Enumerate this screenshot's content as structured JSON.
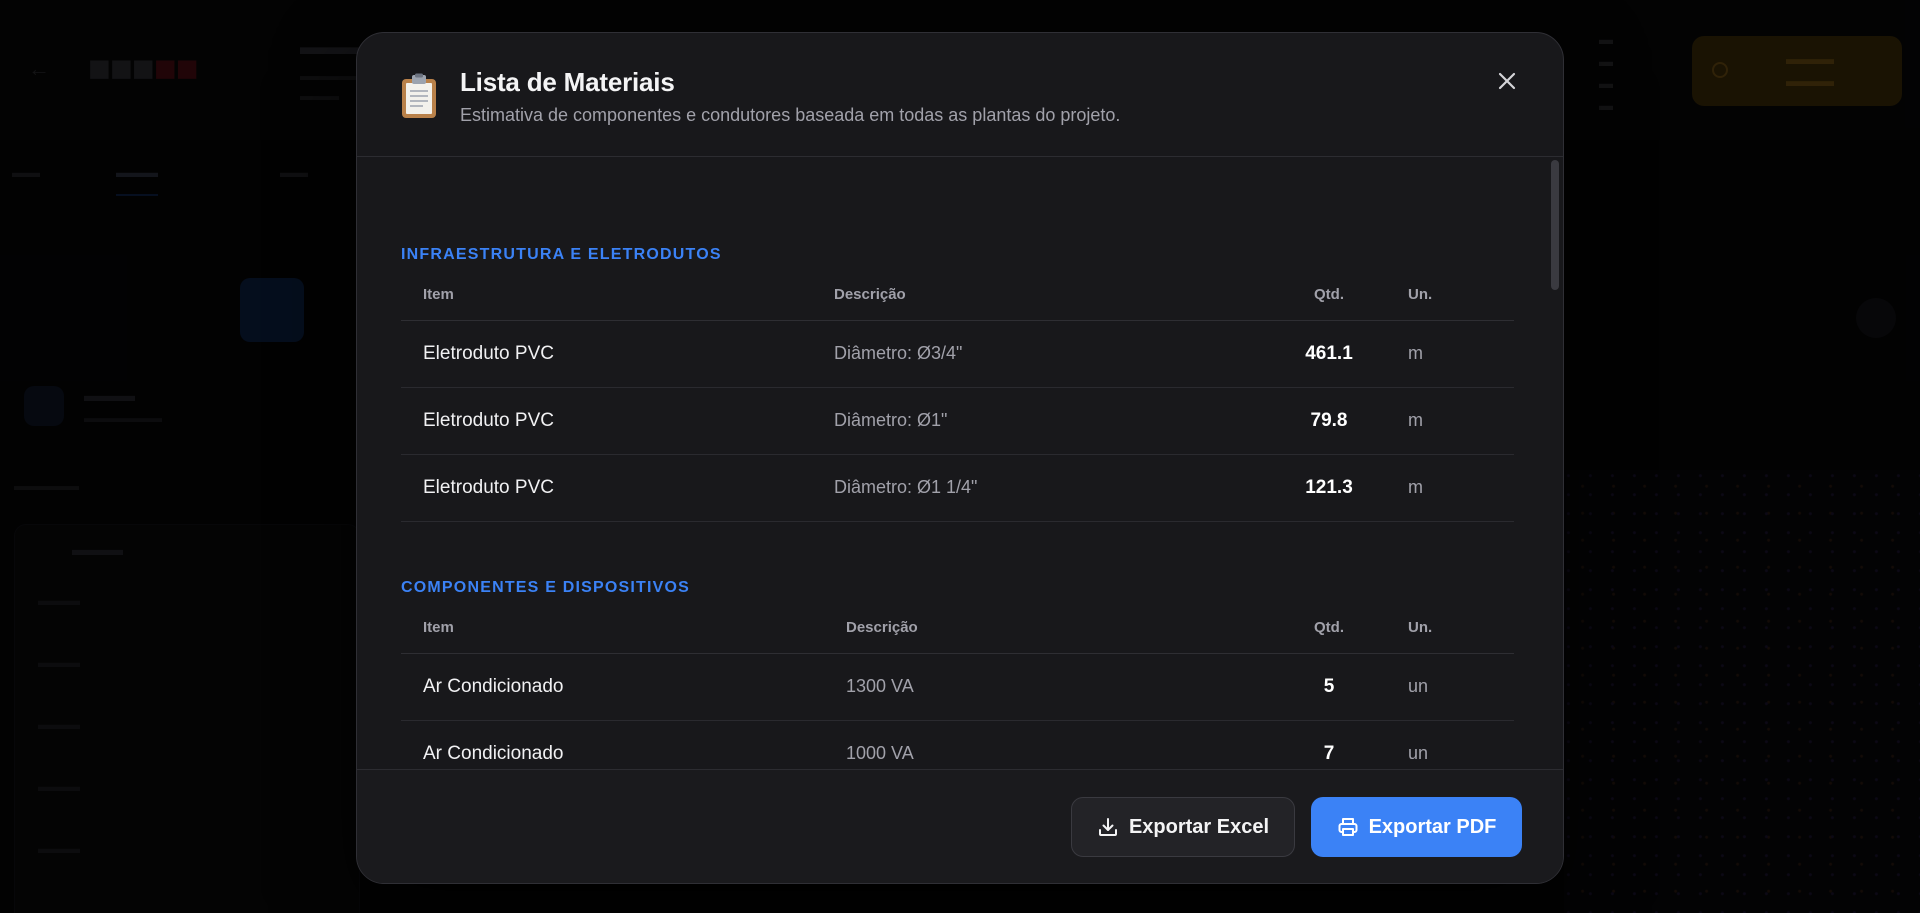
{
  "modal": {
    "title": "Lista de Materiais",
    "subtitle": "Estimativa de componentes e condutores baseada em todas as plantas do projeto.",
    "header_icon": "clipboard-icon",
    "close_icon": "close-icon"
  },
  "sections": [
    {
      "title": "INFRAESTRUTURA E ELETRODUTOS",
      "columns": {
        "item": "Item",
        "description": "Descrição",
        "qty": "Qtd.",
        "unit": "Un."
      },
      "rows": [
        {
          "item": "Eletroduto PVC",
          "description": "Diâmetro: Ø3/4\"",
          "qty": "461.1",
          "unit": "m"
        },
        {
          "item": "Eletroduto PVC",
          "description": "Diâmetro: Ø1\"",
          "qty": "79.8",
          "unit": "m"
        },
        {
          "item": "Eletroduto PVC",
          "description": "Diâmetro: Ø1 1/4\"",
          "qty": "121.3",
          "unit": "m"
        }
      ]
    },
    {
      "title": "COMPONENTES E DISPOSITIVOS",
      "columns": {
        "item": "Item",
        "description": "Descrição",
        "qty": "Qtd.",
        "unit": "Un."
      },
      "rows": [
        {
          "item": "Ar Condicionado",
          "description": "1300 VA",
          "qty": "5",
          "unit": "un"
        },
        {
          "item": "Ar Condicionado",
          "description": "1000 VA",
          "qty": "7",
          "unit": "un"
        }
      ]
    }
  ],
  "footer": {
    "export_excel_label": "Exportar Excel",
    "export_pdf_label": "Exportar PDF",
    "excel_icon": "download-icon",
    "pdf_icon": "printer-icon"
  },
  "colors": {
    "accent": "#3b82f6",
    "modal_bg": "#18181b",
    "page_bg": "#050506"
  }
}
